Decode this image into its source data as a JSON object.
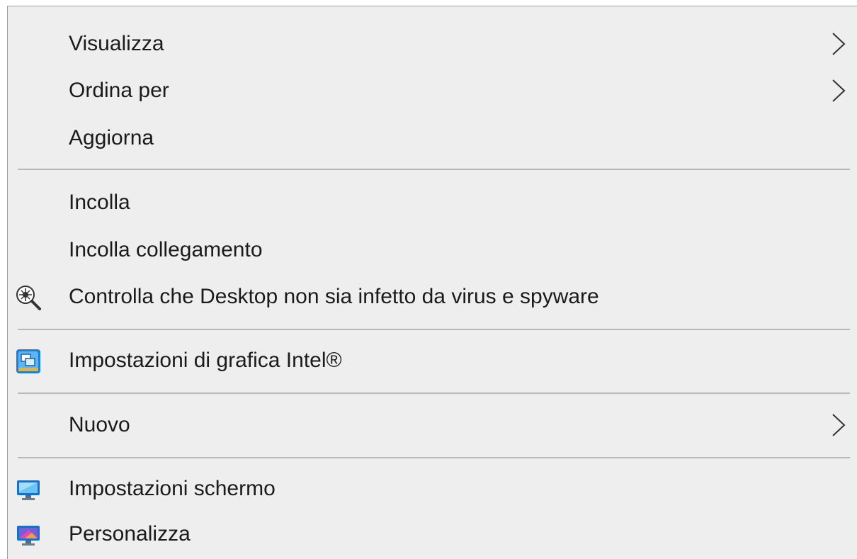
{
  "menu": {
    "items": [
      {
        "label": "Visualizza",
        "icon": "",
        "submenu": true
      },
      {
        "label": "Ordina per",
        "icon": "",
        "submenu": true
      },
      {
        "label": "Aggiorna",
        "icon": "",
        "submenu": false
      },
      {
        "label": "Incolla",
        "icon": "",
        "submenu": false
      },
      {
        "label": "Incolla collegamento",
        "icon": "",
        "submenu": false
      },
      {
        "label": "Controlla che Desktop non sia infetto da virus e spyware",
        "icon": "virus-scan-icon",
        "submenu": false
      },
      {
        "label": "Impostazioni di grafica Intel®",
        "icon": "intel-graphics-icon",
        "submenu": false
      },
      {
        "label": "Nuovo",
        "icon": "",
        "submenu": true
      },
      {
        "label": "Impostazioni schermo",
        "icon": "display-settings-icon",
        "submenu": false
      },
      {
        "label": "Personalizza",
        "icon": "personalize-icon",
        "submenu": false
      }
    ]
  },
  "colors": {
    "background": "#eeeeee",
    "text": "#1b1b1b",
    "separator": "#b8b8b8"
  }
}
